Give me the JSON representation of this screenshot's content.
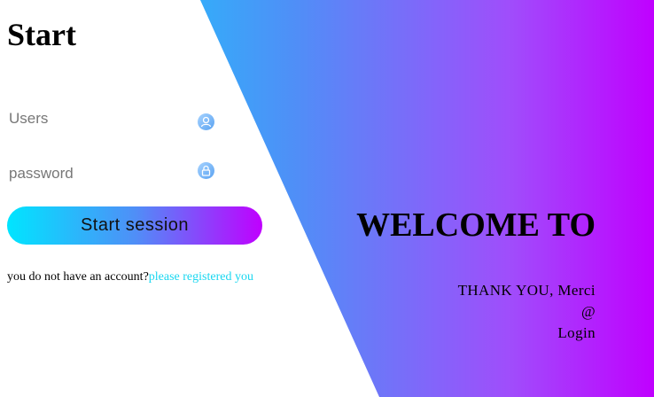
{
  "login": {
    "title": "Start",
    "users_placeholder": "Users",
    "password_placeholder": "password",
    "submit_label": "Start session",
    "signup_prompt": "you do not have an account?",
    "signup_link": "please registered you"
  },
  "welcome": {
    "heading": "WELCOME TO",
    "line1": "THANK YOU, Merci",
    "line2": "@",
    "line3": "Login"
  },
  "colors": {
    "gradient_start": "#00e5ff",
    "gradient_mid": "#4f8ff7",
    "gradient_end": "#c000ff",
    "link": "#1ad7f0"
  },
  "icons": {
    "users": "user-icon",
    "password": "lock-icon"
  }
}
